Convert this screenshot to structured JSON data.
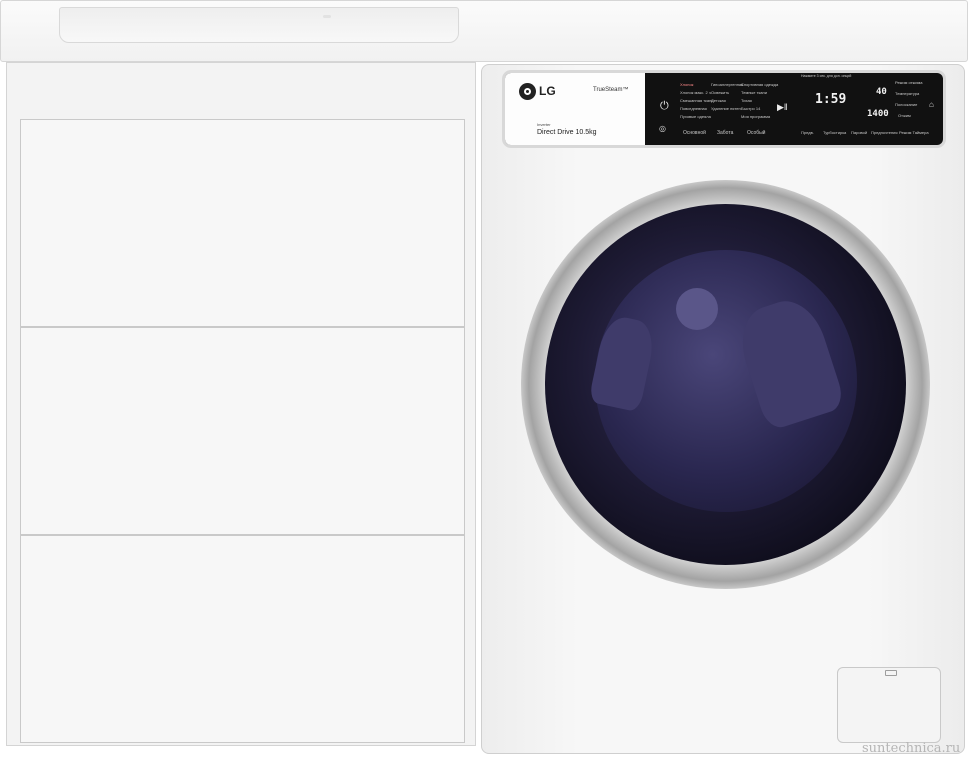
{
  "washer": {
    "brand": "LG",
    "feature": "TrueSteam™",
    "drive_small": "Inverter",
    "drive": "Direct Drive 10.5kg",
    "top_note": "Нажмите 3 сек. для доп. опций",
    "programs": {
      "col1": [
        "Хлопок",
        "Хлопок макс. 2 ч",
        "Смешанная ткань",
        "Повседневная",
        "Пуховые одеяла"
      ],
      "col2": [
        "Гипоаллергенная",
        "Освежить",
        "Детская",
        "Удаление пятен",
        ""
      ],
      "col3": [
        "Спортивная одежда",
        "Темные ткани",
        "Тихая",
        "Быстро 14",
        "Моя программа"
      ]
    },
    "program_tabs": [
      "Основной",
      "Забота",
      "Особый"
    ],
    "display_time": "1:59",
    "spin_label": "Режим отжима",
    "temp_value": "40",
    "temp_label": "Температура",
    "rinse_label": "Полоскание",
    "spin_value": "1400",
    "spin_label2": "Отжим",
    "buttons": [
      "Предв.",
      "Турбостирка",
      "Паровой",
      "Предпочтения",
      "Режим Таймера"
    ]
  },
  "watermark": "suntechnica.ru"
}
